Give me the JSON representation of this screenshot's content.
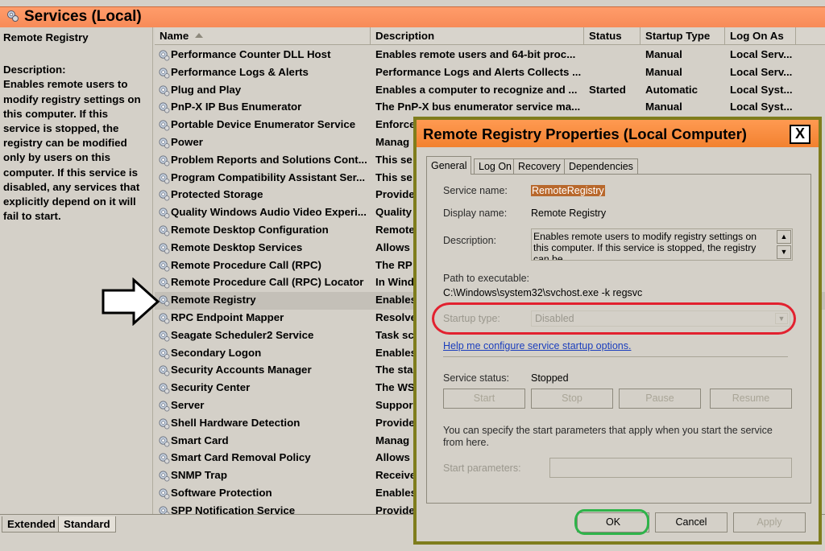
{
  "window": {
    "title": "Services (Local)",
    "icon": "services-icon"
  },
  "left_pane": {
    "service_name": "Remote Registry",
    "description_label": "Description:",
    "description_lines": [
      "Enables remote users to",
      "modify registry settings on",
      "this computer. If this",
      "service is stopped, the",
      "registry can be modified",
      "only by users on this",
      "computer. If this service is",
      "disabled, any services that",
      "explicitly depend on it will",
      "fail to start."
    ]
  },
  "columns": [
    "Name",
    "Description",
    "Status",
    "Startup Type",
    "Log On As"
  ],
  "services": [
    {
      "name": "Performance Counter DLL Host",
      "desc": "Enables remote users and 64-bit proc...",
      "status": "",
      "startup": "Manual",
      "logon": "Local Serv..."
    },
    {
      "name": "Performance Logs & Alerts",
      "desc": "Performance Logs and Alerts Collects ...",
      "status": "",
      "startup": "Manual",
      "logon": "Local Serv..."
    },
    {
      "name": "Plug and Play",
      "desc": "Enables a computer to recognize and ...",
      "status": "Started",
      "startup": "Automatic",
      "logon": "Local Syst..."
    },
    {
      "name": "PnP-X IP Bus Enumerator",
      "desc": "The PnP-X bus enumerator service ma...",
      "status": "",
      "startup": "Manual",
      "logon": "Local Syst..."
    },
    {
      "name": "Portable Device Enumerator Service",
      "desc": "Enforce",
      "status": "",
      "startup": "",
      "logon": ""
    },
    {
      "name": "Power",
      "desc": "Manag",
      "status": "",
      "startup": "",
      "logon": ""
    },
    {
      "name": "Problem Reports and Solutions Cont...",
      "desc": "This se",
      "status": "",
      "startup": "",
      "logon": ""
    },
    {
      "name": "Program Compatibility Assistant Ser...",
      "desc": "This se",
      "status": "",
      "startup": "",
      "logon": ""
    },
    {
      "name": "Protected Storage",
      "desc": "Provide",
      "status": "",
      "startup": "",
      "logon": ""
    },
    {
      "name": "Quality Windows Audio Video Experi...",
      "desc": "Quality",
      "status": "",
      "startup": "",
      "logon": ""
    },
    {
      "name": "Remote Desktop Configuration",
      "desc": "Remote",
      "status": "",
      "startup": "",
      "logon": ""
    },
    {
      "name": "Remote Desktop Services",
      "desc": "Allows",
      "status": "",
      "startup": "",
      "logon": ""
    },
    {
      "name": "Remote Procedure Call (RPC)",
      "desc": "The RP",
      "status": "",
      "startup": "",
      "logon": ""
    },
    {
      "name": "Remote Procedure Call (RPC) Locator",
      "desc": "In Wind",
      "status": "",
      "startup": "",
      "logon": ""
    },
    {
      "name": "Remote Registry",
      "desc": "Enables",
      "status": "",
      "startup": "",
      "logon": "",
      "selected": true
    },
    {
      "name": "RPC Endpoint Mapper",
      "desc": "Resolve",
      "status": "",
      "startup": "",
      "logon": ""
    },
    {
      "name": "Seagate Scheduler2 Service",
      "desc": "Task sc",
      "status": "",
      "startup": "",
      "logon": ""
    },
    {
      "name": "Secondary Logon",
      "desc": "Enables",
      "status": "",
      "startup": "",
      "logon": ""
    },
    {
      "name": "Security Accounts Manager",
      "desc": "The sta",
      "status": "",
      "startup": "",
      "logon": ""
    },
    {
      "name": "Security Center",
      "desc": "The WS",
      "status": "",
      "startup": "",
      "logon": ""
    },
    {
      "name": "Server",
      "desc": "Suppor",
      "status": "",
      "startup": "",
      "logon": ""
    },
    {
      "name": "Shell Hardware Detection",
      "desc": "Provide",
      "status": "",
      "startup": "",
      "logon": ""
    },
    {
      "name": "Smart Card",
      "desc": "Manag",
      "status": "",
      "startup": "",
      "logon": ""
    },
    {
      "name": "Smart Card Removal Policy",
      "desc": "Allows",
      "status": "",
      "startup": "",
      "logon": ""
    },
    {
      "name": "SNMP Trap",
      "desc": "Receive",
      "status": "",
      "startup": "",
      "logon": ""
    },
    {
      "name": "Software Protection",
      "desc": "Enables",
      "status": "",
      "startup": "",
      "logon": ""
    },
    {
      "name": "SPP Notification Service",
      "desc": "Provide",
      "status": "",
      "startup": "",
      "logon": ""
    }
  ],
  "bottom_tabs": [
    "Extended",
    "Standard"
  ],
  "dialog": {
    "title": "Remote Registry Properties (Local Computer)",
    "close": "X",
    "tabs": [
      "General",
      "Log On",
      "Recovery",
      "Dependencies"
    ],
    "service_name_label": "Service name:",
    "service_name": "RemoteRegistry",
    "display_name_label": "Display name:",
    "display_name": "Remote Registry",
    "description_label": "Description:",
    "description": "Enables remote users to modify registry settings on this computer. If this service is stopped, the registry can be",
    "path_label": "Path to executable:",
    "path": "C:\\Windows\\system32\\svchost.exe -k regsvc",
    "startup_label": "Startup type:",
    "startup_value": "Disabled",
    "help_link": "Help me configure service startup options.",
    "status_label": "Service status:",
    "status_value": "Stopped",
    "buttons": {
      "start": "Start",
      "stop": "Stop",
      "pause": "Pause",
      "resume": "Resume"
    },
    "params_note": "You can specify the start parameters that apply when you start the service from here.",
    "params_label": "Start parameters:",
    "ok": "OK",
    "cancel": "Cancel",
    "apply": "Apply"
  },
  "colors": {
    "title_band": "#f78b58",
    "highlight_oval": "#e2212f",
    "ok_oval": "#2fb34a",
    "dialog_frame": "#7f7d1d"
  }
}
